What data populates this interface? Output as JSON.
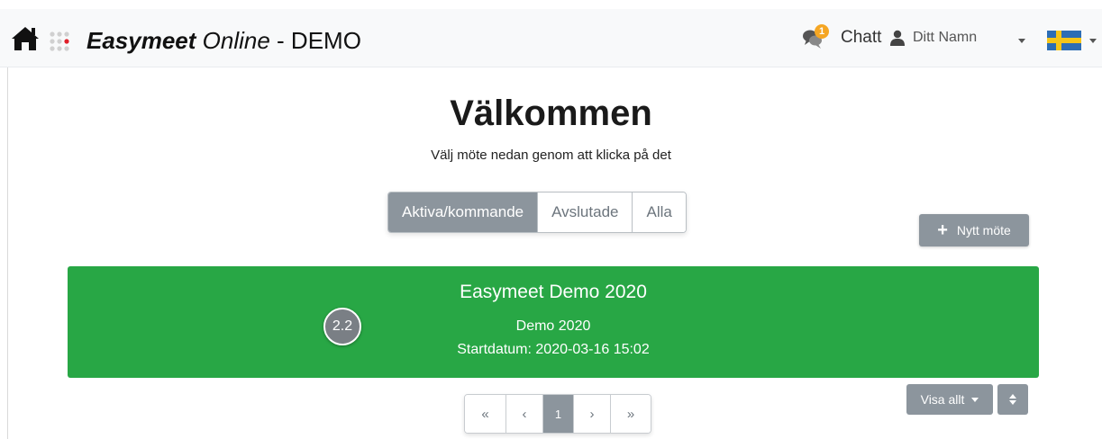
{
  "navbar": {
    "brand_bold": "Easymeet",
    "brand_italic": "Online",
    "brand_suffix": "- DEMO",
    "chat": {
      "label": "Chatt",
      "badge_count": "1",
      "icon": "chat-bubbles-icon"
    },
    "user": {
      "label": "Ditt Namn",
      "icon": "user-icon"
    },
    "language": {
      "icon": "swedish-flag-icon"
    },
    "home_icon": "home-icon",
    "logo_icon": "easymeet-dots-logo"
  },
  "main": {
    "title": "Välkommen",
    "subtitle": "Välj möte nedan genom att klicka på det"
  },
  "filters": [
    {
      "label": "Aktiva/kommande",
      "active": true
    },
    {
      "label": "Avslutade",
      "active": false
    },
    {
      "label": "Alla",
      "active": false
    }
  ],
  "new_meeting": {
    "label": "Nytt möte",
    "icon": "plus-icon"
  },
  "meetings": [
    {
      "title": "Easymeet Demo 2020",
      "name": "Demo 2020",
      "start": "Startdatum: 2020-03-16 15:02",
      "step_badge": "2.2"
    }
  ],
  "pagination": {
    "first": "«",
    "prev": "‹",
    "current": "1",
    "next": "›",
    "last": "»"
  },
  "list_controls": {
    "show_all_label": "Visa allt",
    "sort_icon": "sort-icon"
  },
  "colors": {
    "navbar_bg": "#f8f9fa",
    "meeting_card": "#28a745",
    "secondary_button": "#8c959d",
    "chat_badge": "#f5a623",
    "logo_accent": "#e0202a"
  }
}
